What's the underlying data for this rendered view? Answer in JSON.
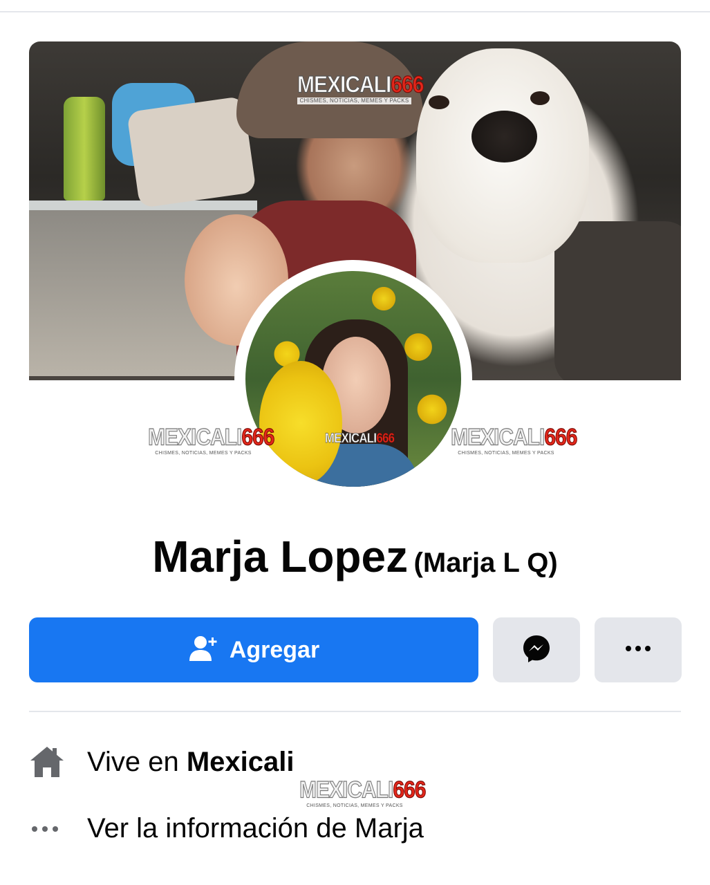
{
  "watermark": {
    "brand": "MEXICALI",
    "number": "666",
    "tagline": "CHISMES, NOTICIAS, MEMES Y PACKS"
  },
  "profile": {
    "name": "Marja Lopez",
    "alternate_name": "(Marja L Q)"
  },
  "actions": {
    "add_label": "Agregar",
    "add_icon": "add-friend-icon",
    "message_icon": "messenger-icon",
    "more_icon": "more-horizontal-icon"
  },
  "info": {
    "lives_prefix": "Vive en",
    "lives_city": "Mexicali",
    "lives_icon": "home-icon",
    "see_about": "Ver la información de Marja",
    "see_about_icon": "more-horizontal-icon"
  },
  "colors": {
    "primary_blue": "#1877f2",
    "button_gray": "#e4e6eb",
    "text_primary": "#050505",
    "text_secondary": "#65676b",
    "watermark_red": "#e4271b"
  }
}
